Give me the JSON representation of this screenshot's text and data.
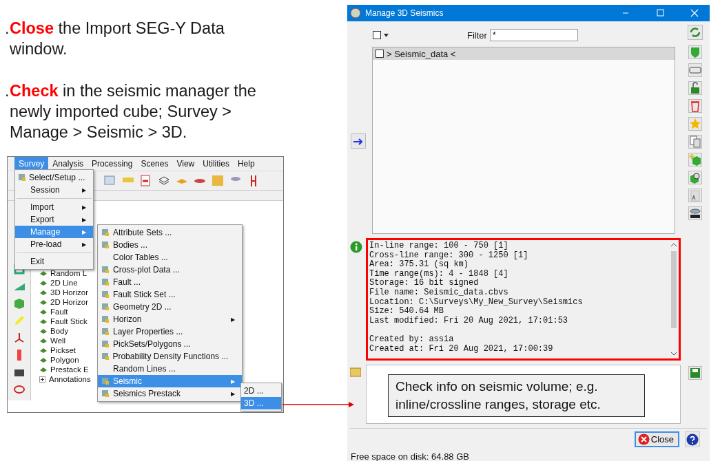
{
  "steps": [
    {
      "marker": ".",
      "text": "**Close** the Import SEG-Y Data window."
    },
    {
      "marker": ".",
      "text": "**Check** in the seismic manager the newly imported cube; Survey > Manage > Seismic > 3D."
    }
  ],
  "app_screenshot": {
    "menubar": [
      {
        "label": "Survey",
        "selected": true
      },
      {
        "label": "Analysis",
        "selected": false
      },
      {
        "label": "Processing",
        "selected": false
      },
      {
        "label": "Scenes",
        "selected": false
      },
      {
        "label": "View",
        "selected": false
      },
      {
        "label": "Utilities",
        "selected": false
      },
      {
        "label": "Help",
        "selected": false
      }
    ],
    "survey_menu": [
      {
        "kind": "item",
        "label": "Select/Setup ...",
        "icon": true,
        "selected": false
      },
      {
        "kind": "item",
        "label": "Session",
        "icon": false,
        "arrow": "▶",
        "selected": false
      },
      {
        "kind": "separator"
      },
      {
        "kind": "item",
        "label": "Import",
        "icon": false,
        "arrow": "▶",
        "selected": false
      },
      {
        "kind": "item",
        "label": "Export",
        "icon": false,
        "arrow": "▶",
        "selected": false
      },
      {
        "kind": "item",
        "label": "Manage",
        "icon": false,
        "arrow": "▶",
        "selected": true
      },
      {
        "kind": "item",
        "label": "Pre-load",
        "icon": false,
        "arrow": "▶",
        "selected": false
      },
      {
        "kind": "separator"
      },
      {
        "kind": "item",
        "label": "Exit",
        "icon": false,
        "selected": false
      }
    ],
    "manage_menu": [
      {
        "label": "Attribute Sets ...",
        "icon": true,
        "selected": false
      },
      {
        "label": "Bodies ...",
        "icon": true,
        "selected": false
      },
      {
        "label": "Color Tables ...",
        "icon": false,
        "selected": false
      },
      {
        "label": "Cross-plot Data ...",
        "icon": true,
        "selected": false
      },
      {
        "label": "Fault ...",
        "icon": true,
        "selected": false
      },
      {
        "label": "Fault Stick Set ...",
        "icon": true,
        "selected": false
      },
      {
        "label": "Geometry 2D ...",
        "icon": true,
        "selected": false
      },
      {
        "label": "Horizon",
        "icon": true,
        "arrow": "▶",
        "selected": false
      },
      {
        "label": "Layer Properties ...",
        "icon": true,
        "selected": false
      },
      {
        "label": "PickSets/Polygons ...",
        "icon": true,
        "selected": false
      },
      {
        "label": "Probability Density Functions ...",
        "icon": true,
        "selected": false
      },
      {
        "label": "Random Lines ...",
        "icon": false,
        "selected": false
      },
      {
        "label": "Seismic",
        "icon": true,
        "arrow": "▶",
        "selected": true
      },
      {
        "label": "Seismics Prestack",
        "icon": true,
        "arrow": "▶",
        "selected": false
      }
    ],
    "seismic_menu": [
      {
        "label": "2D ...",
        "selected": false
      },
      {
        "label": "3D ...",
        "selected": true
      }
    ],
    "tree": [
      {
        "label": "Random L",
        "expandable": false
      },
      {
        "label": "2D Line",
        "expandable": false
      },
      {
        "label": "3D Horizor",
        "expandable": false
      },
      {
        "label": "2D Horizor",
        "expandable": false
      },
      {
        "label": "Fault",
        "expandable": false
      },
      {
        "label": "Fault Stick",
        "expandable": false
      },
      {
        "label": "Body",
        "expandable": false
      },
      {
        "label": "Well",
        "expandable": false
      },
      {
        "label": "Pickset",
        "expandable": false
      },
      {
        "label": "Polygon",
        "expandable": false
      },
      {
        "label": "Prestack E",
        "expandable": false
      },
      {
        "label": "Annotations",
        "expandable": true
      }
    ]
  },
  "dialog": {
    "title": "Manage 3D Seismics",
    "select_all": {
      "checked": false
    },
    "filter": {
      "label": "Filter",
      "value": "*"
    },
    "list": [
      {
        "label": "> Seismic_data <",
        "checked": false
      }
    ],
    "info_lines": [
      "In-line range: 100 - 750 [1]",
      "Cross-line range: 300 - 1250 [1]",
      "Area: 375.31 (sq km)",
      "Time range(ms): 4 - 1848 [4]",
      "Storage: 16 bit signed",
      "File name: Seismic_data.cbvs",
      "Location: C:\\Surveys\\My_New_Survey\\Seismics",
      "Size: 540.64 MB",
      "Last modified: Fri 20 Aug 2021, 17:01:53"
    ],
    "creation_lines": [
      "Created by: assia",
      "Created at: Fri 20 Aug 2021, 17:00:39"
    ],
    "callout": "Check info on seismic volume; e.g. inline/crossline ranges, storage etc.",
    "close_button": "Close",
    "status_bar": "Free space on disk: 64.88 GB"
  }
}
